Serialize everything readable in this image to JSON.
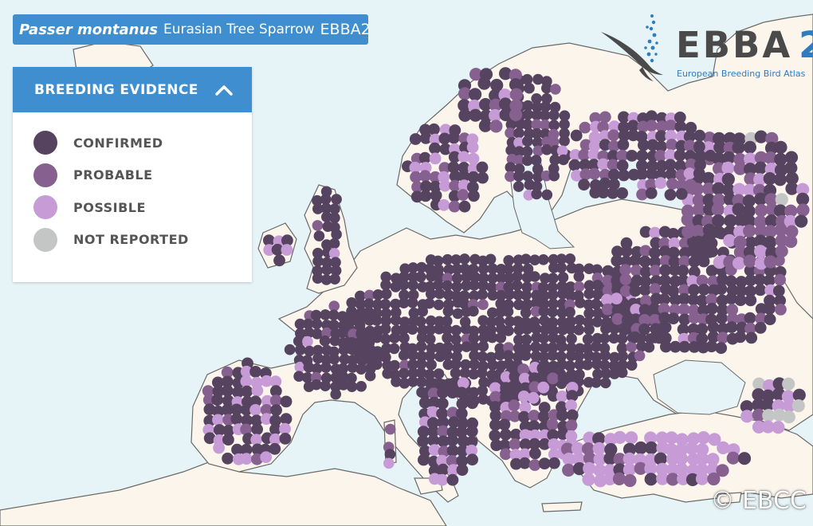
{
  "header": {
    "scientific_name": "Passer montanus",
    "common_name": "Eurasian Tree Sparrow",
    "atlas_code": "EBBA2"
  },
  "legend": {
    "title": "BREEDING EVIDENCE",
    "toggle_icon": "chevron-up-icon",
    "items": [
      {
        "label": "CONFIRMED",
        "color": "#554360"
      },
      {
        "label": "PROBABLE",
        "color": "#86608e"
      },
      {
        "label": "POSSIBLE",
        "color": "#c69bd6"
      },
      {
        "label": "NOT REPORTED",
        "color": "#c4c6c5"
      }
    ]
  },
  "logo": {
    "name": "EBBA",
    "number": "2",
    "subtitle": "European Breeding Bird Atlas"
  },
  "copyright": "© EBCC",
  "colors": {
    "sea": "#e6f3f7",
    "land": "#fcf5ec",
    "accent": "#3f8fd0"
  }
}
